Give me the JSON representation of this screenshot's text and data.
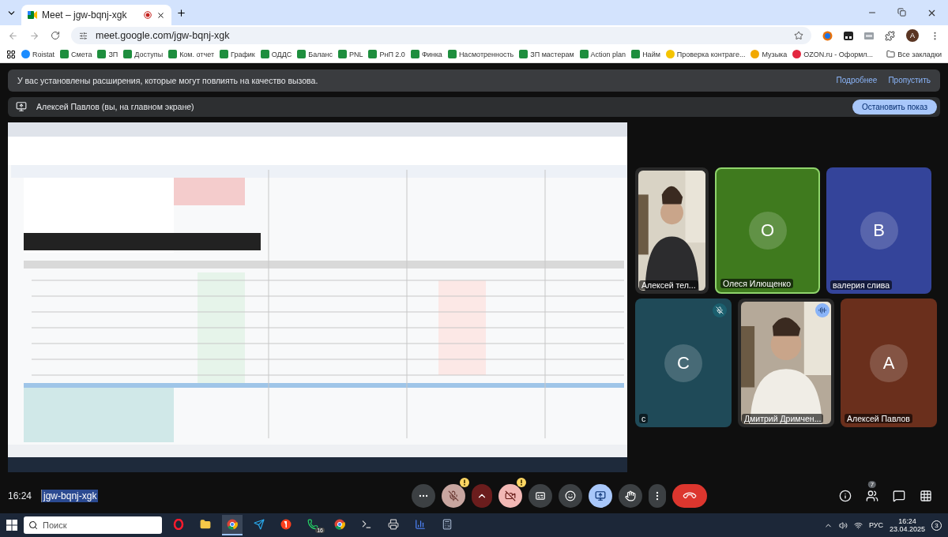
{
  "browser": {
    "tab": {
      "title": "Meet – jgw-bqnj-xgk",
      "recording": true
    },
    "url": "meet.google.com/jgw-bqnj-xgk",
    "profile_initial": "A",
    "bookmarks": [
      {
        "label": "Roistat",
        "kind": "roistat"
      },
      {
        "label": "Смета",
        "kind": "sheet"
      },
      {
        "label": "ЗП",
        "kind": "sheet"
      },
      {
        "label": "Доступы",
        "kind": "sheet"
      },
      {
        "label": "Ком. отчет",
        "kind": "sheet"
      },
      {
        "label": "График",
        "kind": "sheet"
      },
      {
        "label": "ОДДС",
        "kind": "sheet"
      },
      {
        "label": "Баланс",
        "kind": "sheet"
      },
      {
        "label": "PNL",
        "kind": "sheet"
      },
      {
        "label": "РнП 2.0",
        "kind": "sheet"
      },
      {
        "label": "Финка",
        "kind": "sheet"
      },
      {
        "label": "Насмотренность",
        "kind": "sheet"
      },
      {
        "label": "ЗП мастерам",
        "kind": "sheet"
      },
      {
        "label": "Action plan",
        "kind": "sheet"
      },
      {
        "label": "Найм",
        "kind": "sheet"
      },
      {
        "label": "Проверка контраге...",
        "kind": "shield"
      },
      {
        "label": "Музыка",
        "kind": "sun"
      },
      {
        "label": "OZON.ru - Оформл...",
        "kind": "ozon"
      }
    ],
    "all_bookmarks": "Все закладки"
  },
  "meet": {
    "banner": {
      "text": "У вас установлены расширения, которые могут повлиять на качество вызова.",
      "links": [
        "Подробнее",
        "Пропустить"
      ]
    },
    "presenting": {
      "text": "Алексей Павлов (вы, на главном экране)",
      "button": "Остановить показ"
    },
    "tiles": [
      {
        "name": "Алексей тел...",
        "kind": "video",
        "highlighted": false,
        "muted": false,
        "speaking": false
      },
      {
        "name": "Олеся Илющенко",
        "kind": "avatar",
        "initial": "О",
        "color": "#3f7a1e",
        "highlighted": true,
        "muted": false,
        "speaking": false
      },
      {
        "name": "валерия слива",
        "kind": "avatar",
        "initial": "В",
        "color": "#34449a",
        "highlighted": false,
        "muted": false,
        "speaking": false
      },
      {
        "name": "с",
        "kind": "avatar",
        "initial": "С",
        "color": "#1f4a58",
        "highlighted": false,
        "muted": true,
        "speaking": false
      },
      {
        "name": "Дмитрий Дримчен...",
        "kind": "video",
        "highlighted": false,
        "muted": false,
        "speaking": true
      },
      {
        "name": "Алексей Павлов",
        "kind": "avatar",
        "initial": "А",
        "color": "#6a2f1c",
        "highlighted": false,
        "muted": false,
        "speaking": false
      }
    ],
    "time": "16:24",
    "meeting_code": "jgw-bqnj-xgk",
    "controls": [
      {
        "kind": "more"
      },
      {
        "kind": "mic",
        "on": false,
        "warning": true
      },
      {
        "kind": "options"
      },
      {
        "kind": "camera",
        "on": false,
        "warning": true
      },
      {
        "kind": "captions",
        "on": false
      },
      {
        "kind": "emoji"
      },
      {
        "kind": "present",
        "on": true
      },
      {
        "kind": "hand"
      },
      {
        "kind": "menu"
      },
      {
        "kind": "hangup"
      }
    ],
    "people_count": "7"
  },
  "taskbar": {
    "search_placeholder": "Поиск",
    "apps": [
      {
        "kind": "opera"
      },
      {
        "kind": "folder"
      },
      {
        "kind": "chrome",
        "selected": true
      },
      {
        "kind": "telegram"
      },
      {
        "kind": "yandex"
      },
      {
        "kind": "whatsapp",
        "badge": "16"
      },
      {
        "kind": "chrome"
      },
      {
        "kind": "terminal"
      },
      {
        "kind": "printer"
      },
      {
        "kind": "chart"
      },
      {
        "kind": "calculator"
      }
    ],
    "language": "РУС",
    "time": "16:24",
    "date": "23.04.2025",
    "notifications": "3"
  }
}
